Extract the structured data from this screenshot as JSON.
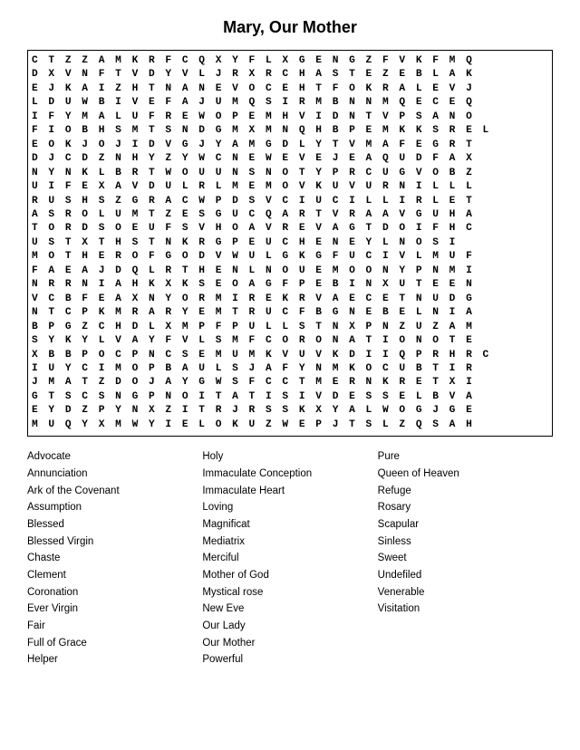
{
  "title": "Mary, Our Mother",
  "puzzle_rows": [
    "C T Z Z A M K R F C Q X Y F L X G E N G Z F V K F M Q",
    "D X V N F T V D Y V L J R X R C H A S T E Z E B L A K",
    "E J K A I Z H T N A N E V O C E H T F O K R A L E V J",
    "L D U W B I V E F A J U M Q S I R M B N N M Q E C E Q",
    "I F Y M A L U F R E W O P E M H V I D N T V P S A N O",
    "F I O B H S M T S N D G M X M N Q H B P E M K K S R E L",
    "E O K J O J I D V G J Y A M G D L Y T V M A F E G R T",
    "D J C D Z N H Y Z Y W C N E W E V E J E A Q U D F A X",
    "N Y N K L B R T W O U U N S N O T Y P R C U G V O B Z",
    "U I F E X A V D U L R L M E M O V K U V U R N I L L L",
    "R U S H S Z G R A C W P D S V C I U C I L L I R L E T",
    "A S R O L U M T Z E S G U C Q A R T V R A A V G U H A",
    "T O R D S O E U F S V H O A V R E V A G T D O I F H C",
    "U S T X T H S T N K R G P E U C H E N E Y L N O S I",
    "M O T H E R O F G O D V W U L G K G F U C I V L M U F",
    "F A E A J D Q L R T H E N L N O U E M O O N Y P N M I",
    "N R R N I A H K X K S E O A G F P E B I N X U T E E N",
    "V C B F E A X N Y O R M I R E K R V A E C E T N U D G",
    "N T C P K M R A R Y E M T R U C F B G N E B E L N I A",
    "B P G Z C H D L X M P F P U L L S T N X P N Z U Z A M",
    "S Y K Y L V A Y F V L S M F C O R O N A T I O N O T E",
    "X B B P O C P N C S E M U M K V U V K D I I Q P R H R C",
    "I U Y C I M O P B A U L S J A F Y N M K O C U B T I R",
    "J M A T Z D O J A Y G W S F C C T M E R N K R E T X I",
    "G T S C S N G P N O I T A T I S I V D E S S E L B V A",
    "E Y D Z P Y N X Z I T R J R S S K X Y A L W O G J G E",
    "M U Q Y X M W Y I E L O K U Z W E P J T S L Z Q S A H"
  ],
  "word_columns": [
    [
      "Advocate",
      "Annunciation",
      "Ark of the Covenant",
      "Assumption",
      "Blessed",
      "Blessed Virgin",
      "Chaste",
      "Clement",
      "Coronation",
      "Ever Virgin",
      "Fair",
      "Full of Grace",
      "Helper"
    ],
    [
      "Holy",
      "Immaculate Conception",
      "Immaculate Heart",
      "Loving",
      "Magnificat",
      "Mediatrix",
      "Merciful",
      "Mother of God",
      "Mystical rose",
      "New Eve",
      "Our Lady",
      "Our Mother",
      "Powerful"
    ],
    [
      "Pure",
      "Queen of Heaven",
      "Refuge",
      "Rosary",
      "Scapular",
      "Sinless",
      "Sweet",
      "Undefiled",
      "Venerable",
      "Visitation",
      "",
      "",
      ""
    ]
  ]
}
